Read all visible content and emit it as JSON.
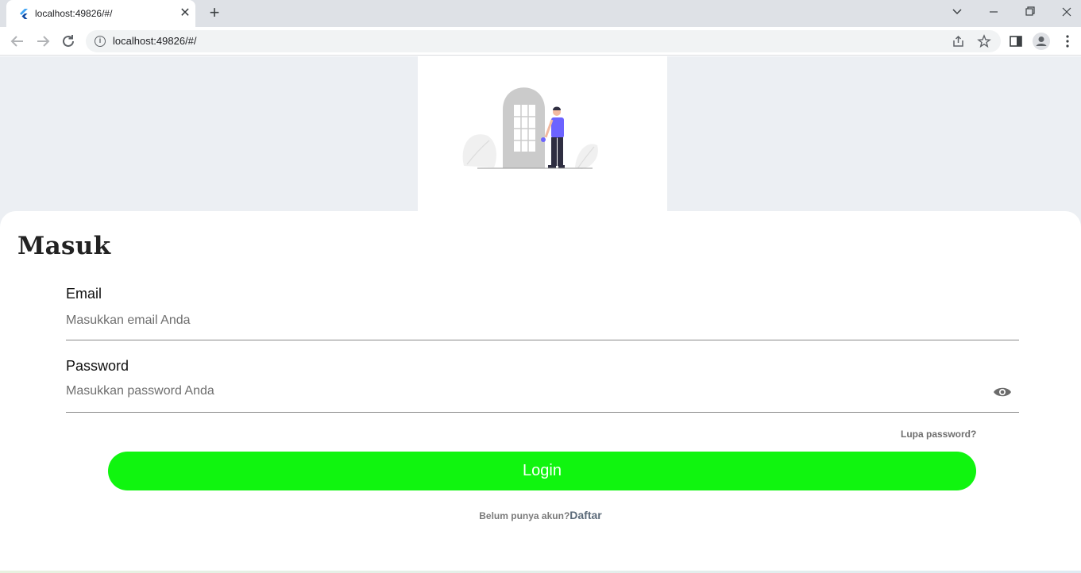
{
  "browser": {
    "tab_title": "localhost:49826/#/",
    "tab_close": "✕",
    "new_tab": "+",
    "url": "localhost:49826/#/"
  },
  "page": {
    "title": "Masuk",
    "email": {
      "label": "Email",
      "placeholder": "Masukkan email Anda",
      "value": ""
    },
    "password": {
      "label": "Password",
      "placeholder": "Masukkan password Anda",
      "value": ""
    },
    "forgot_link": "Lupa password?",
    "login_button": "Login",
    "signup_prompt": "Belum punya akun?",
    "signup_link": "Daftar"
  },
  "colors": {
    "login_button": "#10f50f",
    "page_background": "#eceff3",
    "illustration_accent": "#6c63ff"
  }
}
